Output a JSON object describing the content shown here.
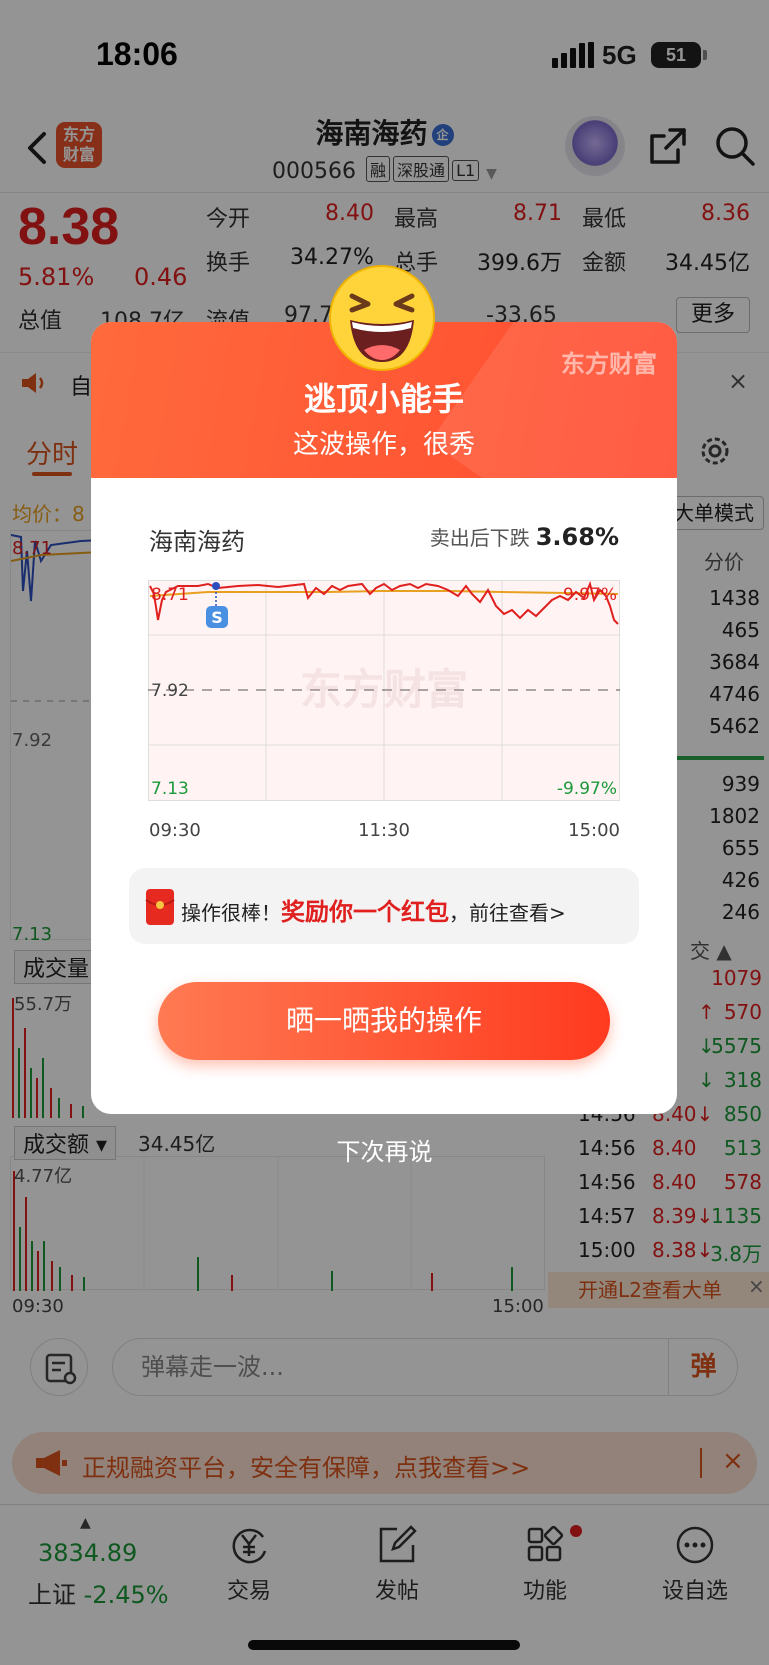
{
  "status_bar": {
    "time": "18:06",
    "network": "5G",
    "battery": "51"
  },
  "header": {
    "app_logo": "东方财富",
    "stock_name": "海南海药",
    "ent_badge": "企",
    "code": "000566",
    "tags": [
      "融",
      "深股通",
      "L1"
    ]
  },
  "quote": {
    "price": "8.38",
    "pct": "5.81%",
    "change": "0.46",
    "items": [
      {
        "label": "今开",
        "value": "8.40"
      },
      {
        "label": "最高",
        "value": "8.71"
      },
      {
        "label": "最低",
        "value": "8.36"
      },
      {
        "label": "换手",
        "value": "34.27%"
      },
      {
        "label": "总手",
        "value": "399.6万"
      },
      {
        "label": "金额",
        "value": "34.45亿"
      }
    ],
    "total_label": "总值",
    "total_value": "108.7亿",
    "float_label": "流值",
    "float_value": "97.7",
    "dyn_value": "-33.65",
    "more": "更多"
  },
  "notice": {
    "text": "自"
  },
  "tabs": {
    "active": "分时"
  },
  "chart": {
    "avg_label": "均价：8",
    "top_price": "8.71",
    "mid_price": "7.92",
    "low_price": "7.13",
    "vol_label": "成交量",
    "vol_max": "55.7万",
    "amt_label": "成交额",
    "amt_total": "34.45亿",
    "amt_max": "4.77亿",
    "time_start": "09:30",
    "time_end": "15:00"
  },
  "order_book": {
    "mode": "大单模式",
    "fenjia": "分价",
    "rows": [
      "1438",
      "465",
      "3684",
      "4746",
      "5462",
      "939",
      "1802",
      "655",
      "426",
      "246"
    ],
    "trade_head": "交"
  },
  "trades": [
    {
      "time": "",
      "price": "",
      "vol": "1079",
      "dir": "red"
    },
    {
      "time": "",
      "price": "↑",
      "vol": "570",
      "dir": "red"
    },
    {
      "time": "",
      "price": "↓",
      "vol": "5575",
      "dir": "green"
    },
    {
      "time": "",
      "price": "↓",
      "vol": "318",
      "dir": "green"
    },
    {
      "time": "14:56",
      "price": "8.40↓",
      "vol": "850",
      "dir": "green"
    },
    {
      "time": "14:56",
      "price": "8.40",
      "vol": "513",
      "dir": "green"
    },
    {
      "time": "14:56",
      "price": "8.40",
      "vol": "578",
      "dir": "green"
    },
    {
      "time": "14:57",
      "price": "8.39↓",
      "vol": "1135",
      "dir": "green"
    },
    {
      "time": "15:00",
      "price": "8.38↓",
      "vol": "3.8万",
      "dir": "green"
    }
  ],
  "l2_bar": "开通L2查看大单",
  "comment": {
    "placeholder": "弹幕走一波...",
    "send": "弹"
  },
  "promo": {
    "text": "正规融资平台，安全有保障，点我查看>>"
  },
  "bottom_nav": {
    "index_value": "3834.89",
    "index_name": "上证",
    "index_pct": "-2.45%",
    "items": [
      {
        "label": "交易",
        "icon": "yen-icon"
      },
      {
        "label": "发帖",
        "icon": "edit-icon"
      },
      {
        "label": "功能",
        "icon": "grid-icon"
      },
      {
        "label": "设自选",
        "icon": "more-icon"
      }
    ]
  },
  "modal": {
    "brand": "东方财富",
    "title": "逃顶小能手",
    "subtitle": "这波操作，很秀",
    "stock": "海南海药",
    "drop_label": "卖出后下跌",
    "drop_value": "3.68%",
    "chart_top_left": "8.71",
    "chart_top_right": "9.97%",
    "chart_mid": "7.92",
    "chart_bot_left": "7.13",
    "chart_bot_right": "-9.97%",
    "watermark": "东方财富",
    "sell_marker": "S",
    "t_start": "09:30",
    "t_mid": "11:30",
    "t_end": "15:00",
    "reward_prefix": "操作很棒！",
    "reward_highlight": "奖励你一个红包",
    "reward_suffix": "，前往查看>",
    "cta": "晒一晒我的操作",
    "later": "下次再说"
  }
}
